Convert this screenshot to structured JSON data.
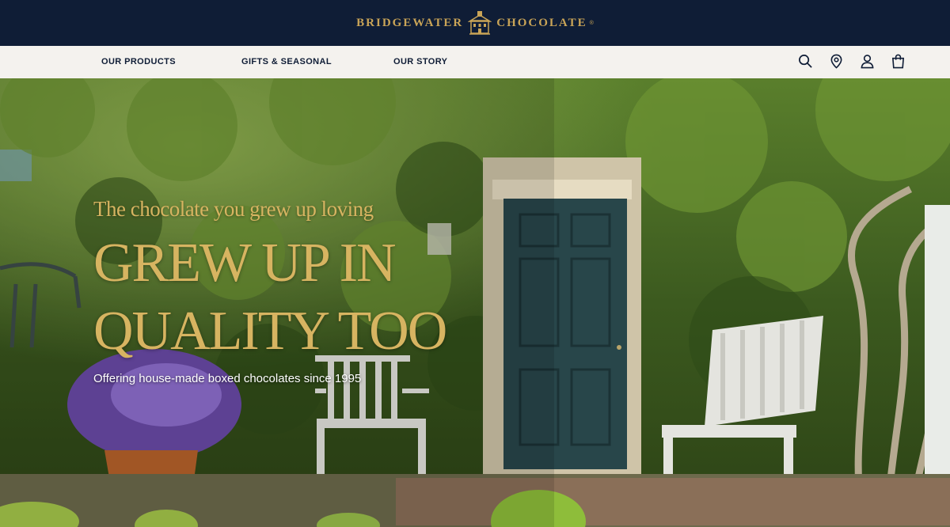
{
  "brand": {
    "left_word": "BRIDGEWATER",
    "right_word": "CHOCOLATE",
    "registered": "®",
    "logo_icon": "house-crest-icon",
    "accent_color": "#c9a457",
    "bar_color": "#0f1d36"
  },
  "nav": {
    "background": "#f4f2ee",
    "links": [
      "OUR PRODUCTS",
      "GIFTS & SEASONAL",
      "OUR STORY"
    ],
    "icons": [
      "search-icon",
      "location-pin-icon",
      "account-icon",
      "shopping-bag-icon"
    ]
  },
  "hero": {
    "tagline": "The chocolate you grew up loving",
    "headline_line1": "GREW UP IN",
    "headline_line2": "QUALITY TOO",
    "subline": "Offering house-made boxed chocolates since 1995",
    "text_color": "#d7b461"
  }
}
